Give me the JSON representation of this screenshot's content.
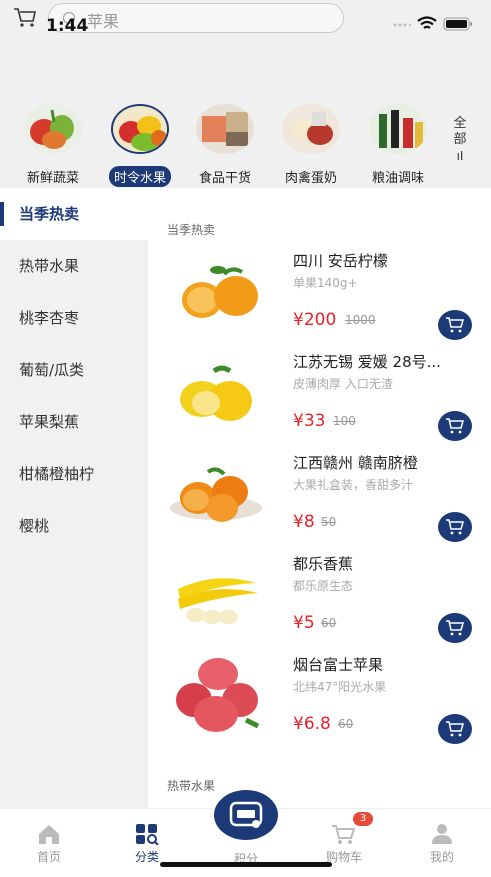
{
  "status": {
    "time": "1:44"
  },
  "search": {
    "placeholder": "苹果"
  },
  "categories": [
    {
      "label": "新鲜蔬菜",
      "active": false
    },
    {
      "label": "时令水果",
      "active": true
    },
    {
      "label": "食品干货",
      "active": false
    },
    {
      "label": "肉禽蛋奶",
      "active": false
    },
    {
      "label": "粮油调味",
      "active": false
    }
  ],
  "all_label": "全部",
  "side_menu": [
    {
      "label": "当季热卖",
      "active": true
    },
    {
      "label": "热带水果"
    },
    {
      "label": "桃李杏枣"
    },
    {
      "label": "葡萄/瓜类"
    },
    {
      "label": "苹果梨蕉"
    },
    {
      "label": "柑橘橙柚柠"
    },
    {
      "label": "樱桃"
    }
  ],
  "section_title": "当季热卖",
  "next_section_title": "热带水果",
  "products": [
    {
      "name": "四川 安岳柠檬",
      "desc": "单果140g+",
      "price": "¥200",
      "orig": "1000",
      "img": "lemon-orange"
    },
    {
      "name": "江苏无锡 爱媛 28号...",
      "desc": "皮薄肉厚 入口无渣",
      "price": "¥33",
      "orig": "100",
      "img": "lemon"
    },
    {
      "name": "江西赣州 赣南脐橙",
      "desc": "大果礼盒装，香甜多汁",
      "price": "¥8",
      "orig": "50",
      "img": "orange"
    },
    {
      "name": "都乐香蕉",
      "desc": "都乐原生态",
      "price": "¥5",
      "orig": "60",
      "img": "banana"
    },
    {
      "name": "烟台富士苹果",
      "desc": "北纬47°阳光水果",
      "price": "¥6.8",
      "orig": "60",
      "img": "apple"
    }
  ],
  "tabs": [
    {
      "label": "首页",
      "icon": "home-icon"
    },
    {
      "label": "分类",
      "icon": "category-icon",
      "active": true
    },
    {
      "label": "积分",
      "icon": "points-icon"
    },
    {
      "label": "购物车",
      "icon": "cart-icon"
    },
    {
      "label": "我的",
      "icon": "user-icon"
    }
  ],
  "cart_badge": "3",
  "colors": {
    "primary": "#1d3a78",
    "price": "#e8212a"
  }
}
